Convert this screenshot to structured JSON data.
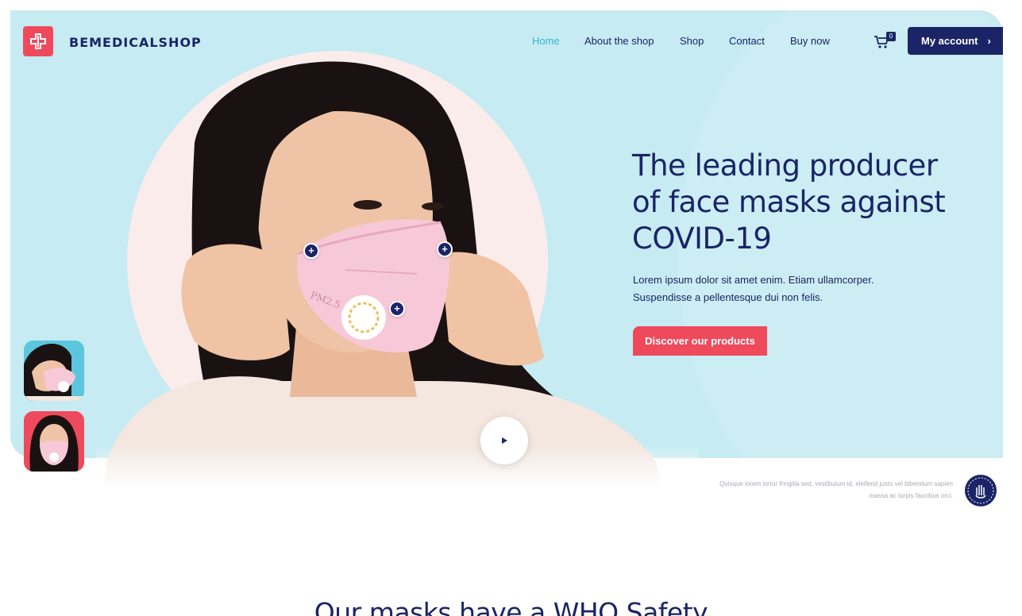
{
  "brand": {
    "name": "BEMEDICALSHOP",
    "logo_icon": "medical-cross-icon",
    "accent": "#ef4a5b",
    "navy": "#1b2467",
    "hero_bg": "#c6ebf2"
  },
  "nav": {
    "items": [
      {
        "label": "Home",
        "active": true
      },
      {
        "label": "About the shop",
        "active": false
      },
      {
        "label": "Shop",
        "active": false
      },
      {
        "label": "Contact",
        "active": false
      },
      {
        "label": "Buy now",
        "active": false
      }
    ],
    "cart_count": "0",
    "account_label": "My account",
    "account_icon": "chevron-right-icon"
  },
  "hero": {
    "title": "The leading producer of face masks against COVID-19",
    "subtitle": "Lorem ipsum dolor sit amet enim. Etiam ullamcorper. Suspendisse a pellentesque dui non felis.",
    "cta_label": "Discover our products",
    "mask_print": "PM2.5",
    "hotspot_label": "+",
    "note": "Quisque lorem tortor fringilla sed, vestibulum id, eleifend justo vel bibendum sapien massa ac turpis faucibus orci."
  },
  "section": {
    "title": "Our masks have a WHO Safety"
  }
}
